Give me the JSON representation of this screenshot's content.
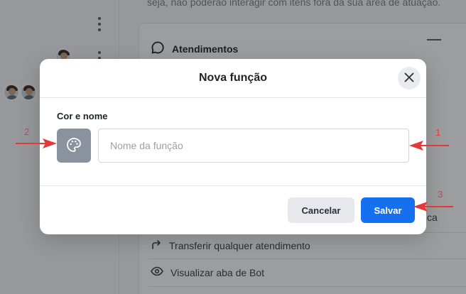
{
  "background": {
    "top_text": "seja, não poderão interagir com itens fora da sua área de atuação.",
    "card_title": "Atendimentos",
    "partial_text": "ca",
    "rows": [
      {
        "label": "Transferir qualquer atendimento",
        "icon": "share-arrow-icon"
      },
      {
        "label": "Visualizar aba de Bot",
        "icon": "eye-icon"
      }
    ]
  },
  "modal": {
    "title": "Nova função",
    "field_label": "Cor e nome",
    "name_input": {
      "value": "",
      "placeholder": "Nome da função"
    },
    "color_swatch": {
      "color": "#8a939d",
      "icon": "palette-icon"
    },
    "buttons": {
      "cancel": "Cancelar",
      "save": "Salvar"
    }
  },
  "annotations": [
    "1",
    "2",
    "3"
  ],
  "colors": {
    "primary": "#1570ef",
    "annotation": "#e23a3a",
    "swatch": "#8a939d"
  }
}
